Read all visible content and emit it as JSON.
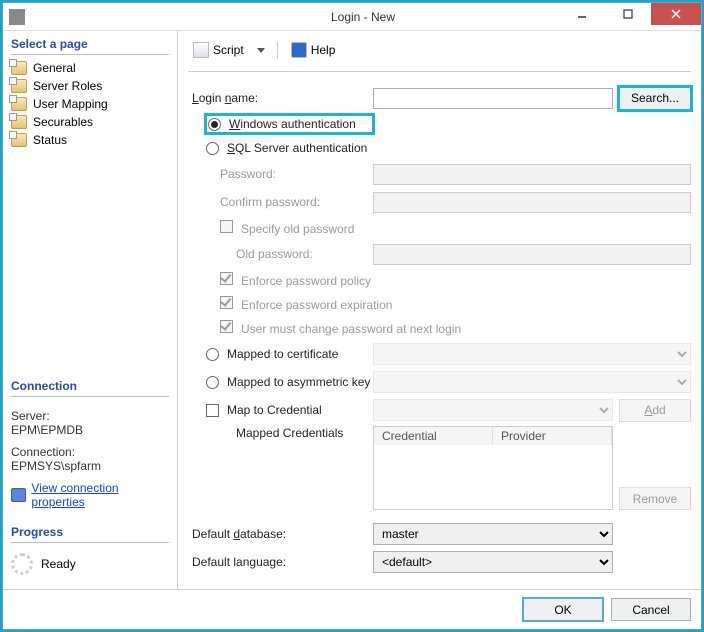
{
  "window": {
    "title": "Login - New"
  },
  "sidebar": {
    "select_page": "Select a page",
    "pages": [
      "General",
      "Server Roles",
      "User Mapping",
      "Securables",
      "Status"
    ],
    "connection_head": "Connection",
    "server_label": "Server:",
    "server_value": "EPM\\EPMDB",
    "connection_label": "Connection:",
    "connection_value": "EPMSYS\\spfarm",
    "view_conn_props": "View connection properties",
    "progress_head": "Progress",
    "progress_status": "Ready"
  },
  "toolbar": {
    "script": "Script",
    "help": "Help"
  },
  "form": {
    "login_name_label": "Login name:",
    "login_name_value": "",
    "search_btn": "Search...",
    "auth_windows": "Windows authentication",
    "auth_sql": "SQL Server authentication",
    "password": "Password:",
    "confirm_password": "Confirm password:",
    "specify_old": "Specify old password",
    "old_password": "Old password:",
    "enforce_policy": "Enforce password policy",
    "enforce_expiration": "Enforce password expiration",
    "must_change": "User must change password at next login",
    "mapped_cert": "Mapped to certificate",
    "mapped_asym": "Mapped to asymmetric key",
    "map_cred": "Map to Credential",
    "add_btn": "Add",
    "mapped_creds": "Mapped Credentials",
    "col_credential": "Credential",
    "col_provider": "Provider",
    "remove_btn": "Remove",
    "default_db_label": "Default database:",
    "default_db_value": "master",
    "default_lang_label": "Default language:",
    "default_lang_value": "<default>"
  },
  "footer": {
    "ok": "OK",
    "cancel": "Cancel"
  }
}
